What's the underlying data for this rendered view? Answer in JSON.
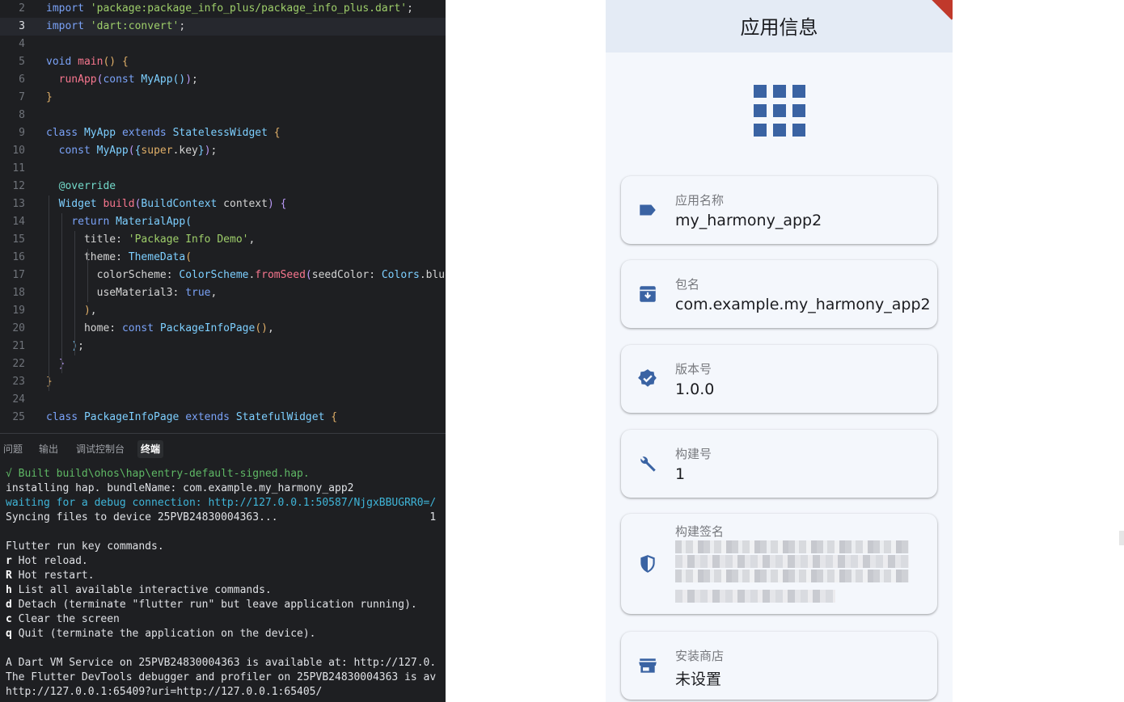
{
  "editor": {
    "lines": [
      {
        "n": "2",
        "html": "<span class=\"k\">import</span> <span class=\"s\">'package:package_info_plus/package_info_plus.dart'</span><span class=\"w\">;</span>"
      },
      {
        "n": "3",
        "html": "<span class=\"k\">import</span> <span class=\"s\">'dart:convert'</span><span class=\"w\">;</span>",
        "active": true
      },
      {
        "n": "4",
        "html": ""
      },
      {
        "n": "5",
        "html": "<span class=\"k\">void</span> <span class=\"f\">main</span><span class=\"y\">()</span> <span class=\"y\">{</span>"
      },
      {
        "n": "6",
        "html": "  <span class=\"f\">runApp</span><span class=\"m\">(</span><span class=\"k\">const</span> <span class=\"c\">MyApp</span><span class=\"c\">()</span><span class=\"m\">)</span><span class=\"w\">;</span>"
      },
      {
        "n": "7",
        "html": "<span class=\"y\">}</span>"
      },
      {
        "n": "8",
        "html": ""
      },
      {
        "n": "9",
        "html": "<span class=\"k\">class</span> <span class=\"c\">MyApp</span> <span class=\"k\">extends</span> <span class=\"c\">StatelessWidget</span> <span class=\"y\">{</span>"
      },
      {
        "n": "10",
        "html": "  <span class=\"k\">const</span> <span class=\"c\">MyApp</span><span class=\"m\">(</span><span class=\"c\">{</span><span class=\"y\">super</span><span class=\"w\">.key</span><span class=\"c\">}</span><span class=\"m\">)</span><span class=\"w\">;</span>"
      },
      {
        "n": "11",
        "html": ""
      },
      {
        "n": "12",
        "html": "  <span class=\"a\">@override</span>"
      },
      {
        "n": "13",
        "html": "  <span class=\"c\">Widget</span> <span class=\"f\">build</span><span class=\"m\">(</span><span class=\"c\">BuildContext</span> <span class=\"w\">context</span><span class=\"m\">)</span> <span class=\"m\">{</span>"
      },
      {
        "n": "14",
        "html": "    <span class=\"k\">return</span> <span class=\"c\">MaterialApp</span><span class=\"c\">(</span>"
      },
      {
        "n": "15",
        "html": "      <span class=\"w\">title:</span> <span class=\"s\">'Package Info Demo'</span><span class=\"w\">,</span>"
      },
      {
        "n": "16",
        "html": "      <span class=\"w\">theme:</span> <span class=\"c\">ThemeData</span><span class=\"y\">(</span>"
      },
      {
        "n": "17",
        "html": "        <span class=\"w\">colorScheme:</span> <span class=\"c\">ColorScheme</span><span class=\"w\">.</span><span class=\"f\">fromSeed</span><span class=\"m\">(</span><span class=\"w\">seedColor:</span> <span class=\"c\">Colors</span><span class=\"w\">.blue</span>"
      },
      {
        "n": "18",
        "html": "        <span class=\"w\">useMaterial3:</span> <span class=\"k\">true</span><span class=\"w\">,</span>"
      },
      {
        "n": "19",
        "html": "      <span class=\"y\">)</span><span class=\"w\">,</span>"
      },
      {
        "n": "20",
        "html": "      <span class=\"w\">home:</span> <span class=\"k\">const</span> <span class=\"c\">PackageInfoPage</span><span class=\"y\">()</span><span class=\"w\">,</span>"
      },
      {
        "n": "21",
        "html": "    <span class=\"c\">)</span><span class=\"w\">;</span>"
      },
      {
        "n": "22",
        "html": "  <span class=\"m\">}</span>"
      },
      {
        "n": "23",
        "html": "<span class=\"y\">}</span>"
      },
      {
        "n": "24",
        "html": ""
      },
      {
        "n": "25",
        "html": "<span class=\"k\">class</span> <span class=\"c\">PackageInfoPage</span> <span class=\"k\">extends</span> <span class=\"c\">StatefulWidget</span> <span class=\"y\">{</span>"
      }
    ]
  },
  "panel": {
    "tabs": [
      {
        "label": "问题",
        "active": false
      },
      {
        "label": "输出",
        "active": false
      },
      {
        "label": "调试控制台",
        "active": false
      },
      {
        "label": "终端",
        "active": true
      }
    ]
  },
  "terminal": {
    "lines": [
      {
        "text": "√ Built build\\ohos\\hap\\entry-default-signed.hap.",
        "style": "green"
      },
      {
        "text": "installing hap. bundleName: com.example.my_harmony_app2",
        "style": ""
      },
      {
        "text": "waiting for a debug connection: http://127.0.0.1:50587/NjgxBBUGRR0=/",
        "style": "cyan"
      },
      {
        "text": "Syncing files to device 25PVB24830004363...                        1",
        "style": ""
      },
      {
        "text": "",
        "style": ""
      },
      {
        "text": "Flutter run key commands.",
        "style": ""
      },
      {
        "key": "r",
        "text": " Hot reload.",
        "style": ""
      },
      {
        "key": "R",
        "text": " Hot restart.",
        "style": ""
      },
      {
        "key": "h",
        "text": " List all available interactive commands.",
        "style": ""
      },
      {
        "key": "d",
        "text": " Detach (terminate \"flutter run\" but leave application running).",
        "style": ""
      },
      {
        "key": "c",
        "text": " Clear the screen",
        "style": ""
      },
      {
        "key": "q",
        "text": " Quit (terminate the application on the device).",
        "style": ""
      },
      {
        "text": "",
        "style": ""
      },
      {
        "text": "A Dart VM Service on 25PVB24830004363 is available at: http://127.0.",
        "style": ""
      },
      {
        "text": "The Flutter DevTools debugger and profiler on 25PVB24830004363 is av",
        "style": ""
      },
      {
        "text": "http://127.0.0.1:65409?uri=http://127.0.0.1:65405/",
        "style": ""
      }
    ]
  },
  "app": {
    "title": "应用信息",
    "header_icon": "apps-grid-icon",
    "cards": [
      {
        "icon": "label-icon",
        "label": "应用名称",
        "value": "my_harmony_app2"
      },
      {
        "icon": "archive-icon",
        "label": "包名",
        "value": "com.example.my_harmony_app2"
      },
      {
        "icon": "verified-icon",
        "label": "版本号",
        "value": "1.0.0"
      },
      {
        "icon": "build-icon",
        "label": "构建号",
        "value": "1"
      },
      {
        "icon": "security-icon",
        "label": "构建签名",
        "value": ""
      },
      {
        "icon": "store-icon",
        "label": "安装商店",
        "value": "未设置"
      }
    ],
    "accent": "#3a63a3"
  }
}
